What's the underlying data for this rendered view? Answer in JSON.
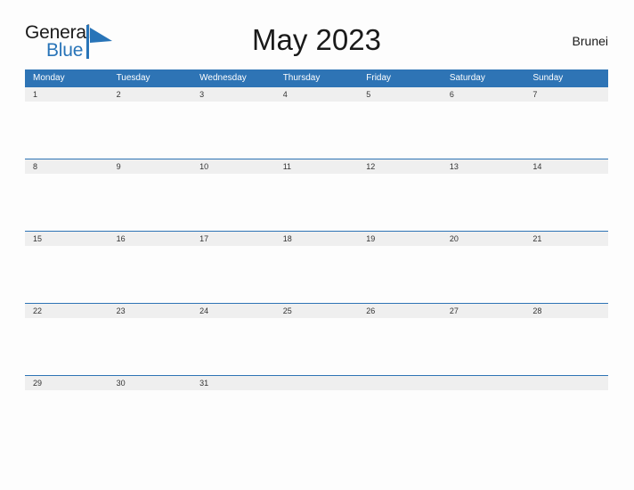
{
  "header": {
    "logo": {
      "text_top": "General",
      "text_bottom": "Blue",
      "icon": "triangle-flag-icon",
      "color_top": "#1a1a1a",
      "color_bottom": "#2874b8"
    },
    "title": "May 2023",
    "country": "Brunei"
  },
  "calendar": {
    "accent_color": "#2e74b5",
    "date_band_color": "#efefef",
    "weekdays": [
      "Monday",
      "Tuesday",
      "Wednesday",
      "Thursday",
      "Friday",
      "Saturday",
      "Sunday"
    ],
    "weeks": [
      [
        "1",
        "2",
        "3",
        "4",
        "5",
        "6",
        "7"
      ],
      [
        "8",
        "9",
        "10",
        "11",
        "12",
        "13",
        "14"
      ],
      [
        "15",
        "16",
        "17",
        "18",
        "19",
        "20",
        "21"
      ],
      [
        "22",
        "23",
        "24",
        "25",
        "26",
        "27",
        "28"
      ],
      [
        "29",
        "30",
        "31",
        "",
        "",
        "",
        ""
      ]
    ]
  }
}
